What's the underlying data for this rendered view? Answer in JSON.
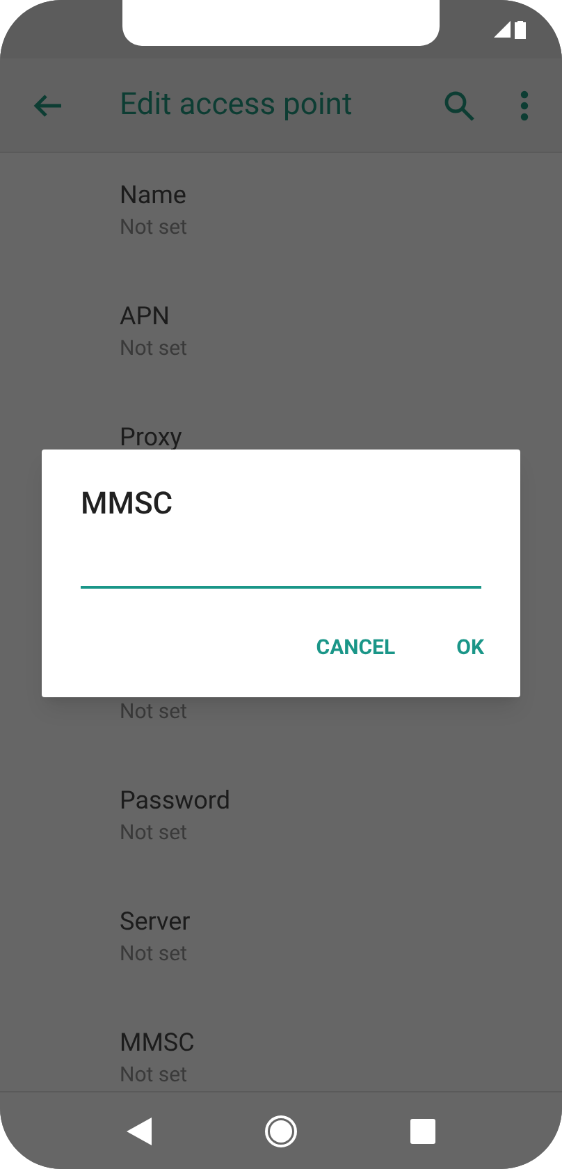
{
  "app_bar": {
    "title": "Edit access point"
  },
  "settings": [
    {
      "title": "Name",
      "value": "Not set"
    },
    {
      "title": "APN",
      "value": "Not set"
    },
    {
      "title": "Proxy"
    },
    {
      "value": "Not set"
    },
    {
      "title": "Password",
      "value": "Not set"
    },
    {
      "title": "Server",
      "value": "Not set"
    },
    {
      "title": "MMSC",
      "value": "Not set"
    }
  ],
  "dialog": {
    "title": "MMSC",
    "buttons": [
      "CANCEL",
      "OK"
    ]
  }
}
